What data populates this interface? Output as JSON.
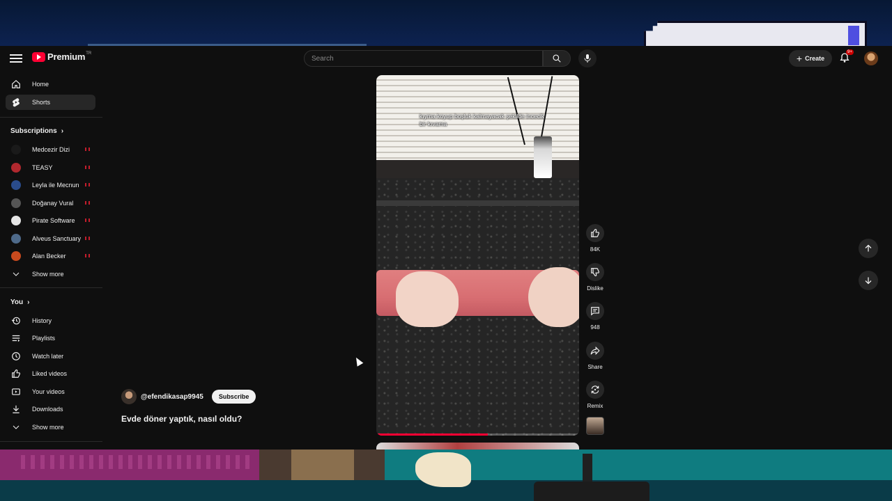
{
  "header": {
    "logo_text": "Premium",
    "country_code": "TR",
    "search_placeholder": "Search",
    "create_label": "Create",
    "notifications_badge": "9+"
  },
  "sidebar": {
    "main": [
      {
        "label": "Home",
        "icon": "home-icon"
      },
      {
        "label": "Shorts",
        "icon": "shorts-icon",
        "active": true
      }
    ],
    "subscriptions_title": "Subscriptions",
    "subscriptions": [
      {
        "label": "Medcezir Dizi",
        "color": "#1a1a1a"
      },
      {
        "label": "TEASY",
        "color": "#b0282e"
      },
      {
        "label": "Leyla ile Mecnun",
        "color": "#2a4c8c"
      },
      {
        "label": "Doğanay Vural",
        "color": "#555555"
      },
      {
        "label": "Pirate Software",
        "color": "#e5e5e5"
      },
      {
        "label": "Alveus Sanctuary",
        "color": "#4e6a8a"
      },
      {
        "label": "Alan Becker",
        "color": "#c84a1e"
      }
    ],
    "subs_show_more": "Show more",
    "you_title": "You",
    "you_items": [
      {
        "label": "History",
        "icon": "history-icon"
      },
      {
        "label": "Playlists",
        "icon": "playlists-icon"
      },
      {
        "label": "Watch later",
        "icon": "clock-icon"
      },
      {
        "label": "Liked videos",
        "icon": "thumbs-up-icon"
      },
      {
        "label": "Your videos",
        "icon": "video-icon"
      },
      {
        "label": "Downloads",
        "icon": "download-icon"
      }
    ],
    "you_show_more": "Show more"
  },
  "short": {
    "caption": "kıyma koyup boşluk kalmayacak şekilde incecik bir kıvama",
    "progress_fraction": 0.55,
    "channel_handle": "@efendikasap9945",
    "subscribe_label": "Subscribe",
    "title": "Evde döner yaptık, nasıl oldu?"
  },
  "actions": {
    "like_count": "84K",
    "dislike_label": "Dislike",
    "comment_count": "948",
    "share_label": "Share",
    "remix_label": "Remix"
  },
  "colors": {
    "brand_red": "#ff0033",
    "live_dot": "#c41d2c",
    "background": "#0f0f0f"
  }
}
